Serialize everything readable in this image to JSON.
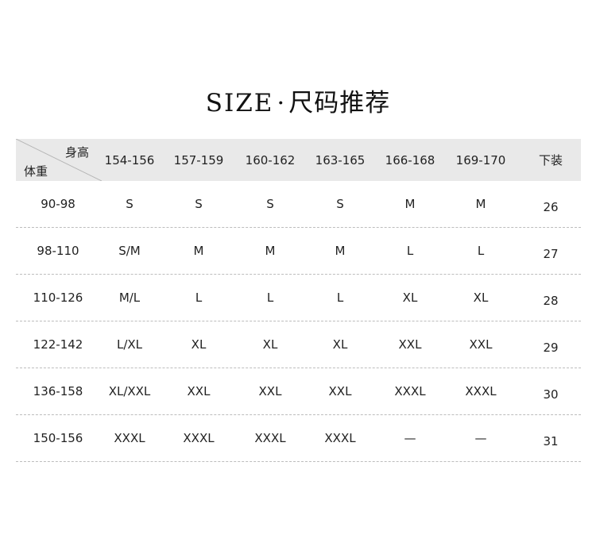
{
  "title": {
    "latin": "SIZE",
    "dot": "·",
    "cn": "尺码推荐"
  },
  "table": {
    "corner": {
      "height_label": "身高",
      "weight_label": "体重"
    },
    "headers": [
      "154-156",
      "157-159",
      "160-162",
      "163-165",
      "166-168",
      "169-170",
      "下装"
    ],
    "rows": [
      {
        "weight": "90-98",
        "sizes": [
          "S",
          "S",
          "S",
          "S",
          "M",
          "M"
        ],
        "bottom": "26"
      },
      {
        "weight": "98-110",
        "sizes": [
          "S/M",
          "M",
          "M",
          "M",
          "L",
          "L"
        ],
        "bottom": "27"
      },
      {
        "weight": "110-126",
        "sizes": [
          "M/L",
          "L",
          "L",
          "L",
          "XL",
          "XL"
        ],
        "bottom": "28"
      },
      {
        "weight": "122-142",
        "sizes": [
          "L/XL",
          "XL",
          "XL",
          "XL",
          "XXL",
          "XXL"
        ],
        "bottom": "29"
      },
      {
        "weight": "136-158",
        "sizes": [
          "XL/XXL",
          "XXL",
          "XXL",
          "XXL",
          "XXXL",
          "XXXL"
        ],
        "bottom": "30"
      },
      {
        "weight": "150-156",
        "sizes": [
          "XXXL",
          "XXXL",
          "XXXL",
          "XXXL",
          "—",
          "—"
        ],
        "bottom": "31"
      }
    ]
  }
}
